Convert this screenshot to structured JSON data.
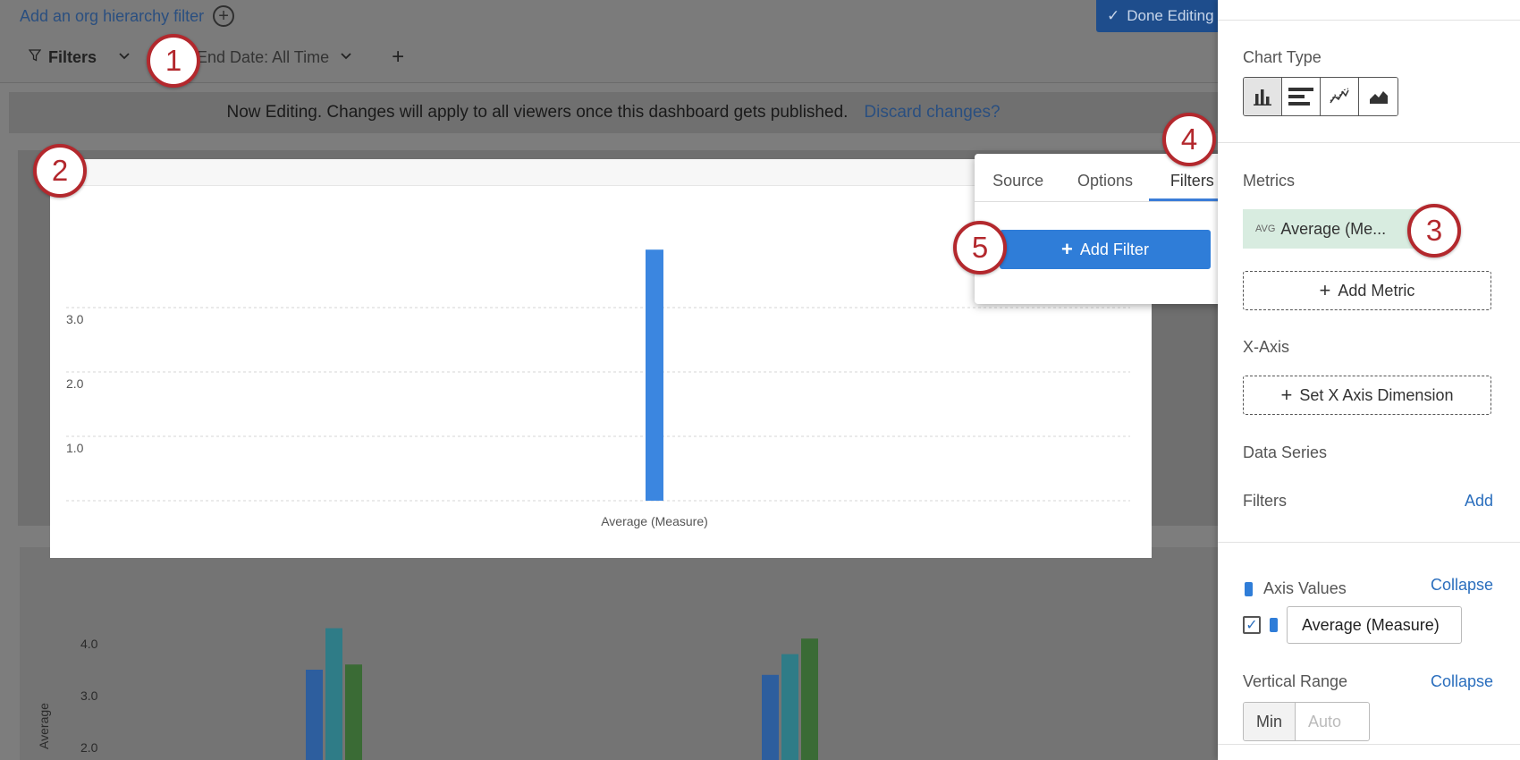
{
  "topbar": {
    "org_filter_link": "Add an org hierarchy filter",
    "done_editing": "Done Editing",
    "filters_label": "Filters",
    "end_date_label": "End Date: All Time"
  },
  "banner": {
    "message": "Now Editing. Changes will apply to all viewers once this dashboard gets published.",
    "discard_link": "Discard changes?"
  },
  "chart1": {
    "y_ticks": [
      "3.0",
      "2.0",
      "1.0"
    ],
    "x_label": "Average (Measure)"
  },
  "chart2": {
    "y_ticks": [
      "4.0",
      "3.0",
      "2.0"
    ],
    "y_axis_label": "Average"
  },
  "chart_data": [
    {
      "type": "bar",
      "categories": [
        "Average (Measure)"
      ],
      "series": [
        {
          "values": [
            3.9
          ]
        }
      ],
      "ylim": [
        0,
        4
      ],
      "grid": true,
      "colors": [
        "#3b86e0"
      ]
    },
    {
      "type": "bar",
      "categories": [
        "",
        ""
      ],
      "series": [
        {
          "values": [
            3.5,
            3.4
          ]
        },
        {
          "values": [
            4.3,
            3.8
          ]
        },
        {
          "values": [
            3.6,
            4.1
          ]
        }
      ],
      "colors": [
        "#2d5e9e",
        "#2f7c87",
        "#3a6b35"
      ]
    }
  ],
  "popover": {
    "tabs": [
      "Source",
      "Options",
      "Filters"
    ],
    "active_tab": "Filters",
    "add_filter_label": "Add Filter"
  },
  "panel": {
    "chart_type_label": "Chart Type",
    "metrics_label": "Metrics",
    "metric_chip_prefix": "AVG",
    "metric_chip_label": "Average (Me...",
    "add_metric_label": "Add Metric",
    "x_axis_label": "X-Axis",
    "set_x_axis_label": "Set X Axis Dimension",
    "data_series_label": "Data Series",
    "filters_label": "Filters",
    "filters_add_link": "Add",
    "axis_values_label": "Axis Values",
    "collapse_link": "Collapse",
    "series_value": "Average (Measure)",
    "vertical_range_label": "Vertical Range",
    "collapse_link_2": "Collapse",
    "range_min_label": "Min",
    "range_auto_placeholder": "Auto"
  },
  "badges": [
    "1",
    "2",
    "3",
    "4",
    "5"
  ],
  "colors": {
    "accent": "#2f7dd8",
    "badge": "#b3282d",
    "metric_chip_bg": "#d8ece0"
  }
}
